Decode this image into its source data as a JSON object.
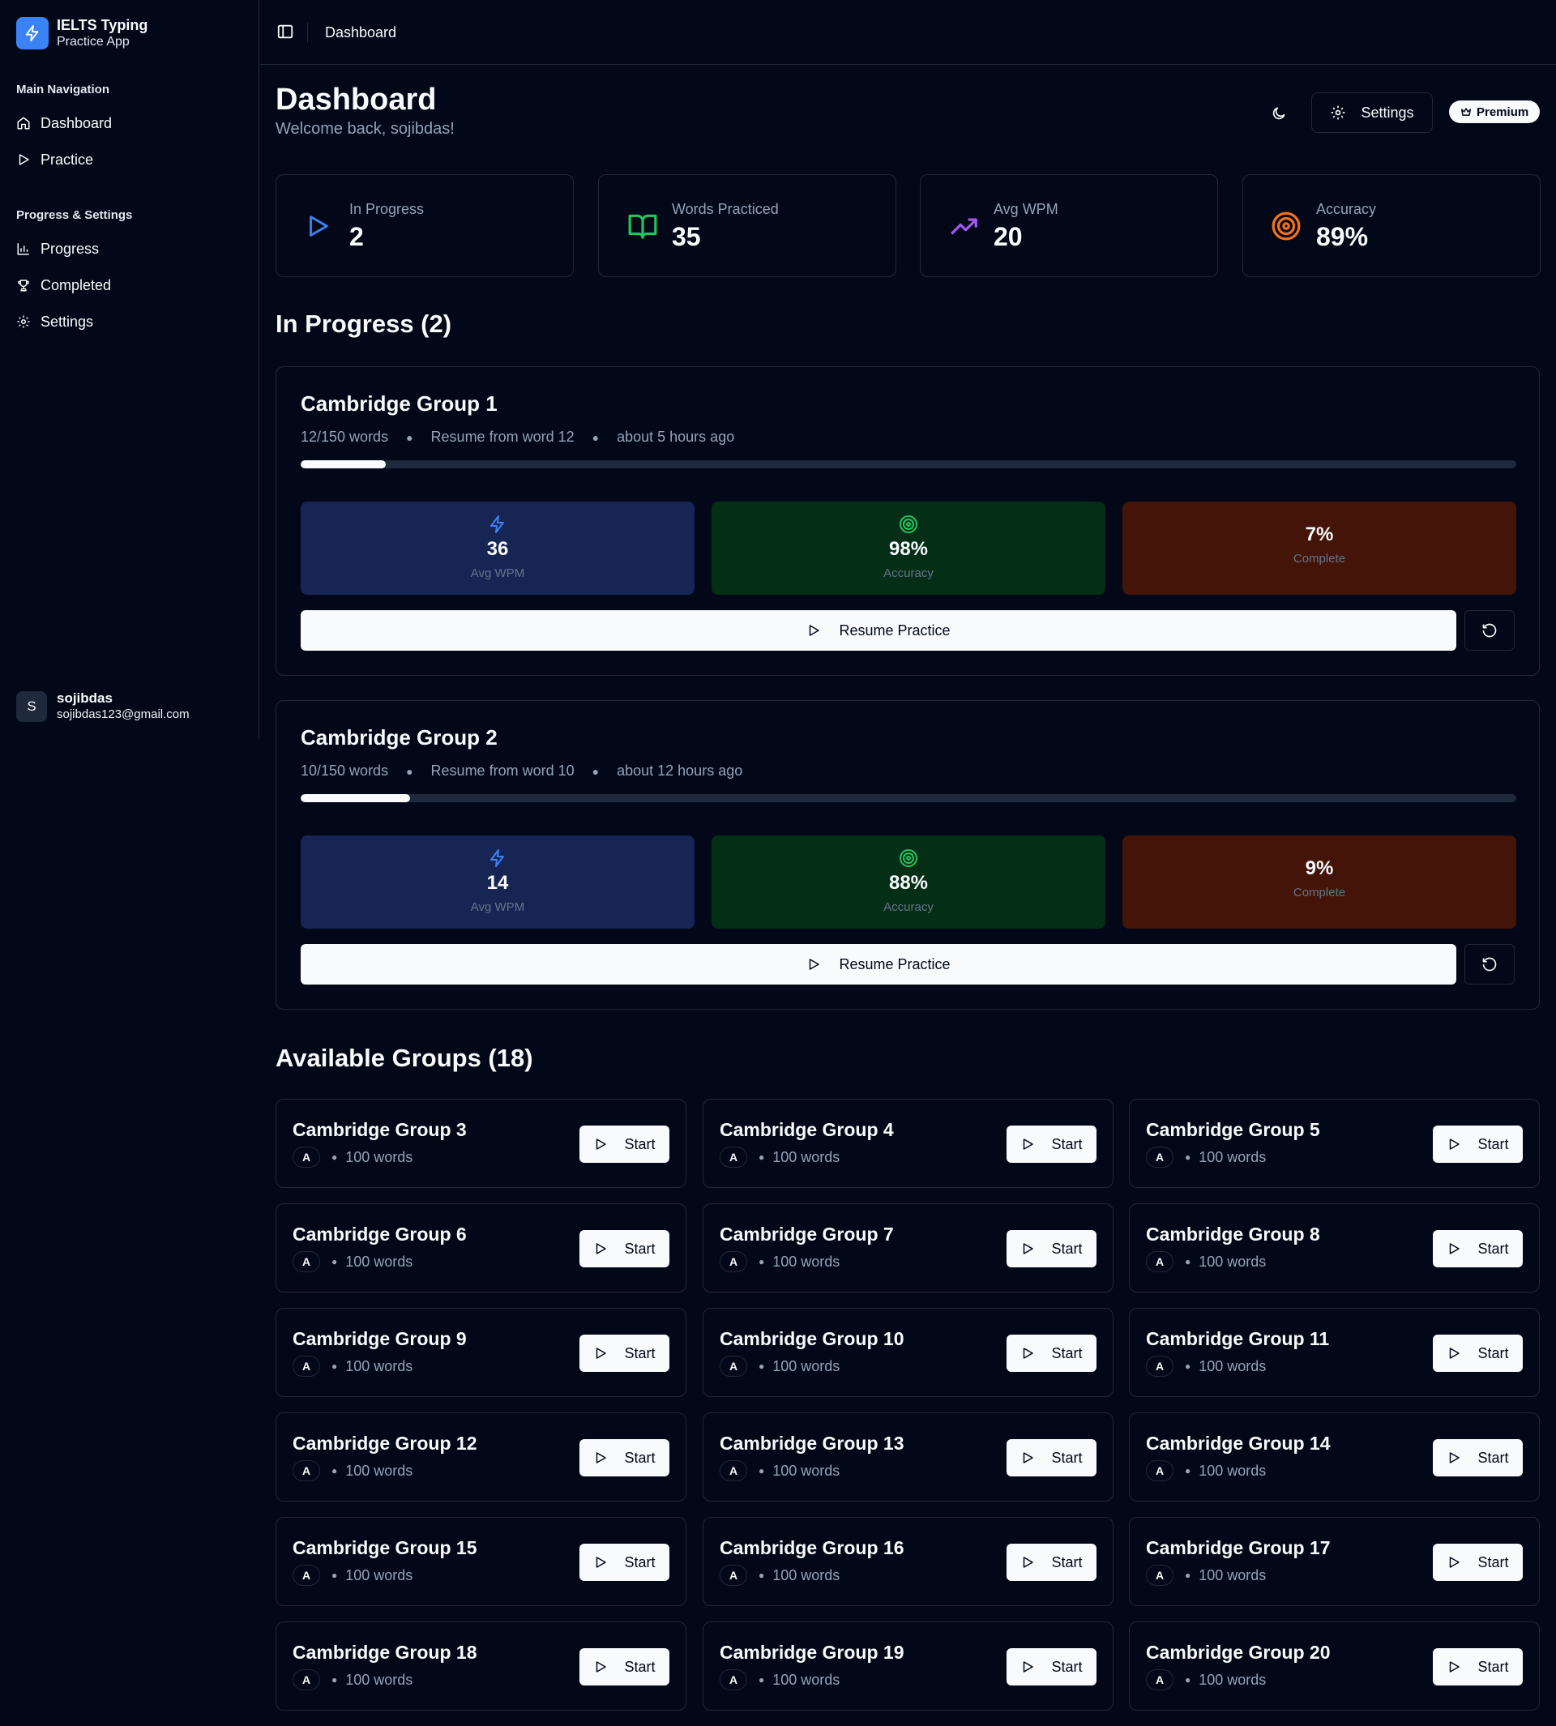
{
  "app": {
    "title": "IELTS Typing",
    "subtitle": "Practice App"
  },
  "sidebar": {
    "main_label": "Main Navigation",
    "main_items": [
      {
        "label": "Dashboard",
        "icon": "home-icon"
      },
      {
        "label": "Practice",
        "icon": "play-icon"
      }
    ],
    "progress_label": "Progress & Settings",
    "progress_items": [
      {
        "label": "Progress",
        "icon": "bar-chart-icon"
      },
      {
        "label": "Completed",
        "icon": "trophy-icon"
      },
      {
        "label": "Settings",
        "icon": "gear-icon"
      }
    ]
  },
  "user": {
    "initial": "S",
    "name": "sojibdas",
    "email": "sojibdas123@gmail.com"
  },
  "topbar": {
    "breadcrumb": "Dashboard"
  },
  "header": {
    "title": "Dashboard",
    "subtitle": "Welcome back, sojibdas!",
    "settings_label": "Settings",
    "premium_label": "Premium"
  },
  "stats": [
    {
      "label": "In Progress",
      "value": "2",
      "icon": "play-icon",
      "color": "#3b82f6"
    },
    {
      "label": "Words Practiced",
      "value": "35",
      "icon": "book-icon",
      "color": "#22c55e"
    },
    {
      "label": "Avg WPM",
      "value": "20",
      "icon": "trending-up-icon",
      "color": "#a855f7"
    },
    {
      "label": "Accuracy",
      "value": "89%",
      "icon": "target-icon",
      "color": "#f97316"
    }
  ],
  "in_progress": {
    "title": "In Progress (2)",
    "resume_label": "Resume Practice",
    "items": [
      {
        "name": "Cambridge Group 1",
        "words": "12/150 words",
        "resume_from": "Resume from word 12",
        "time": "about 5 hours ago",
        "progress": 0.07,
        "wpm": "36",
        "wpm_label": "Avg WPM",
        "accuracy": "98%",
        "accuracy_label": "Accuracy",
        "complete": "7%",
        "complete_label": "Complete"
      },
      {
        "name": "Cambridge Group 2",
        "words": "10/150 words",
        "resume_from": "Resume from word 10",
        "time": "about 12 hours ago",
        "progress": 0.09,
        "wpm": "14",
        "wpm_label": "Avg WPM",
        "accuracy": "88%",
        "accuracy_label": "Accuracy",
        "complete": "9%",
        "complete_label": "Complete"
      }
    ]
  },
  "available": {
    "title": "Available Groups (18)",
    "start_label": "Start",
    "groups": [
      {
        "name": "Cambridge Group 3",
        "level": "A",
        "words": "100 words"
      },
      {
        "name": "Cambridge Group 4",
        "level": "A",
        "words": "100 words"
      },
      {
        "name": "Cambridge Group 5",
        "level": "A",
        "words": "100 words"
      },
      {
        "name": "Cambridge Group 6",
        "level": "A",
        "words": "100 words"
      },
      {
        "name": "Cambridge Group 7",
        "level": "A",
        "words": "100 words"
      },
      {
        "name": "Cambridge Group 8",
        "level": "A",
        "words": "100 words"
      },
      {
        "name": "Cambridge Group 9",
        "level": "A",
        "words": "100 words"
      },
      {
        "name": "Cambridge Group 10",
        "level": "A",
        "words": "100 words"
      },
      {
        "name": "Cambridge Group 11",
        "level": "A",
        "words": "100 words"
      },
      {
        "name": "Cambridge Group 12",
        "level": "A",
        "words": "100 words"
      },
      {
        "name": "Cambridge Group 13",
        "level": "A",
        "words": "100 words"
      },
      {
        "name": "Cambridge Group 14",
        "level": "A",
        "words": "100 words"
      },
      {
        "name": "Cambridge Group 15",
        "level": "A",
        "words": "100 words"
      },
      {
        "name": "Cambridge Group 16",
        "level": "A",
        "words": "100 words"
      },
      {
        "name": "Cambridge Group 17",
        "level": "A",
        "words": "100 words"
      },
      {
        "name": "Cambridge Group 18",
        "level": "A",
        "words": "100 words"
      },
      {
        "name": "Cambridge Group 19",
        "level": "A",
        "words": "100 words"
      },
      {
        "name": "Cambridge Group 20",
        "level": "A",
        "words": "100 words"
      }
    ]
  }
}
